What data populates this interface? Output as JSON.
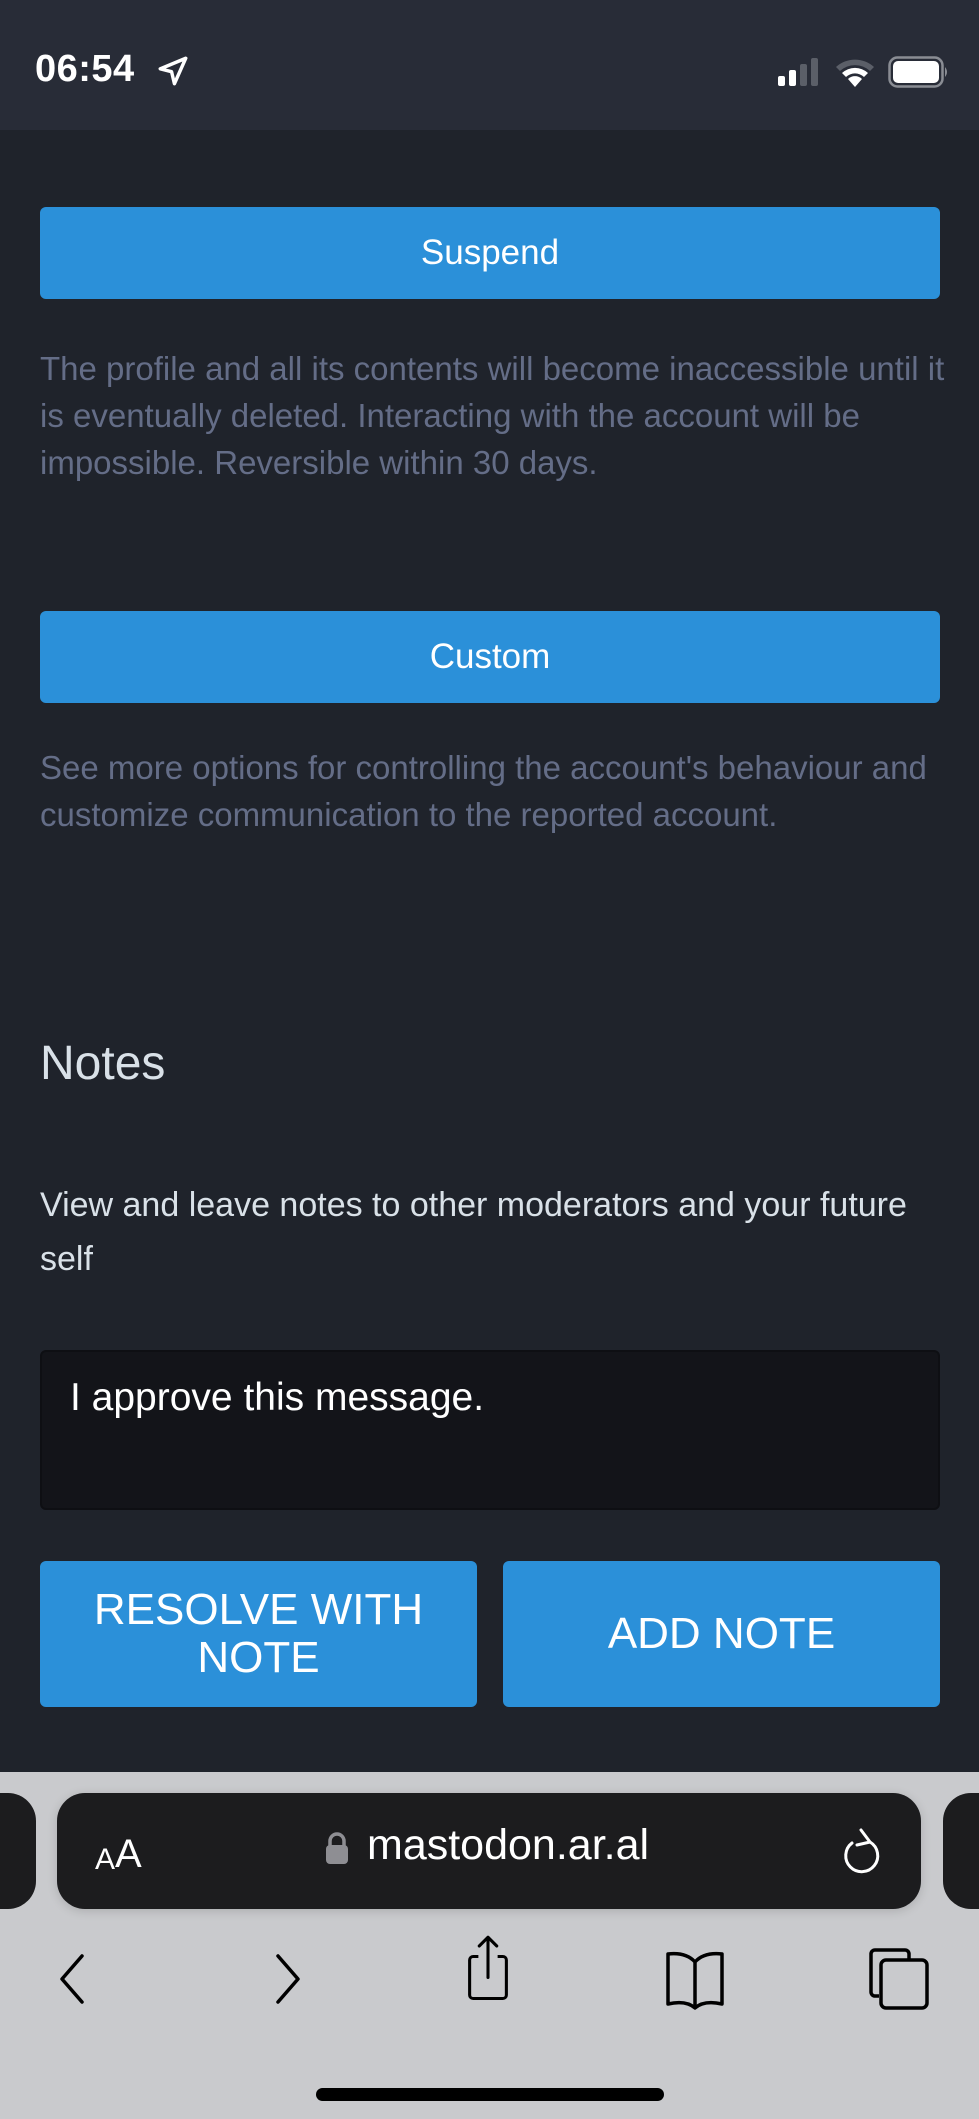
{
  "status_bar": {
    "time": "06:54",
    "icons": [
      "location-arrow-icon",
      "cellular-signal-icon",
      "wifi-icon",
      "battery-icon"
    ]
  },
  "actions": {
    "suspend": {
      "label": "Suspend",
      "description": "The profile and all its contents will become inaccessible until it is eventually deleted. Interacting with the account will be impossible. Reversible within 30 days."
    },
    "custom": {
      "label": "Custom",
      "description": "See more options for controlling the account's behaviour and customize communication to the reported account."
    }
  },
  "notes": {
    "title": "Notes",
    "description": "View and leave notes to other moderators and your future self",
    "input_value": "I approve this message.",
    "resolve_button": "RESOLVE WITH NOTE",
    "add_button": "ADD NOTE"
  },
  "browser": {
    "aa_label_small": "A",
    "aa_label_large": "A",
    "url": "mastodon.ar.al",
    "toolbar_icons": [
      "back-icon",
      "forward-icon",
      "share-icon",
      "bookmarks-icon",
      "tabs-icon"
    ]
  },
  "colors": {
    "accent": "#2b90d9",
    "background": "#1f232b",
    "muted_text": "#646d87",
    "primary_text": "#d9e1e8"
  }
}
